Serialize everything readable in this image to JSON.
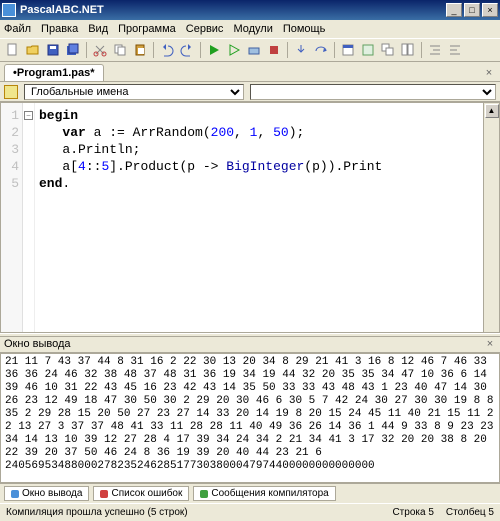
{
  "window": {
    "title": "PascalABC.NET"
  },
  "menu": [
    "Файл",
    "Правка",
    "Вид",
    "Программа",
    "Сервис",
    "Модули",
    "Помощь"
  ],
  "tab": {
    "name": "•Program1.pas*"
  },
  "scope": {
    "selected": "Глобальные имена"
  },
  "code": {
    "lines": [
      {
        "n": "1",
        "html": "<span class=\"kw\">begin</span>"
      },
      {
        "n": "2",
        "html": "   <span class=\"kw\">var</span> a := ArrRandom(<span class=\"num\">200</span>, <span class=\"num\">1</span>, <span class=\"num\">50</span>);"
      },
      {
        "n": "3",
        "html": "   a.Println;"
      },
      {
        "n": "4",
        "html": "   a[<span class=\"num\">4</span>::<span class=\"num\">5</span>].Product(p -&gt; <span class=\"ty\">BigInteger</span>(p)).Print"
      },
      {
        "n": "5",
        "html": "<span class=\"kw\">end</span>."
      }
    ]
  },
  "outpanel": {
    "title": "Окно вывода"
  },
  "output": "21 11 7 43 37 44 8 31 16 2 22 30 13 20 34 8 29 21 41 3 16 8 12 46 7 46 33 36 36 24 46 32 38 48 37 48 31 36 19 34 19 44 32 20 35 35 34 47 10 36 6 14 39 46 10 31 22 43 45 16 23 42 43 14 35 50 33 33 43 48 43 1 23 40 47 14 30 26 23 12 49 18 47 30 50 30 2 29 20 30 46 6 30 5 7 42 24 30 27 30 30 19 8 8 35 2 29 28 15 20 50 27 23 27 14 33 20 14 19 8 20 15 24 45 11 40 21 15 11 22 13 27 3 37 37 48 41 33 11 28 28 11 40 49 36 26 14 36 1 44 9 33 8 9 23 23 34 14 13 10 39 12 27 28 4 17 39 34 24 34 2 21 34 41 3 17 32 20 20 38 8 20 22 39 20 37 50 46 24 8 36 19 39 20 40 44 23 21 6\n24056953488000278235246285177303800047974400000000000000",
  "bottabs": {
    "out": "Окно вывода",
    "err": "Список ошибок",
    "msg": "Сообщения компилятора"
  },
  "status": {
    "msg": "Компиляция прошла успешно (5 строк)",
    "line": "Строка   5",
    "col": "Столбец  5"
  }
}
